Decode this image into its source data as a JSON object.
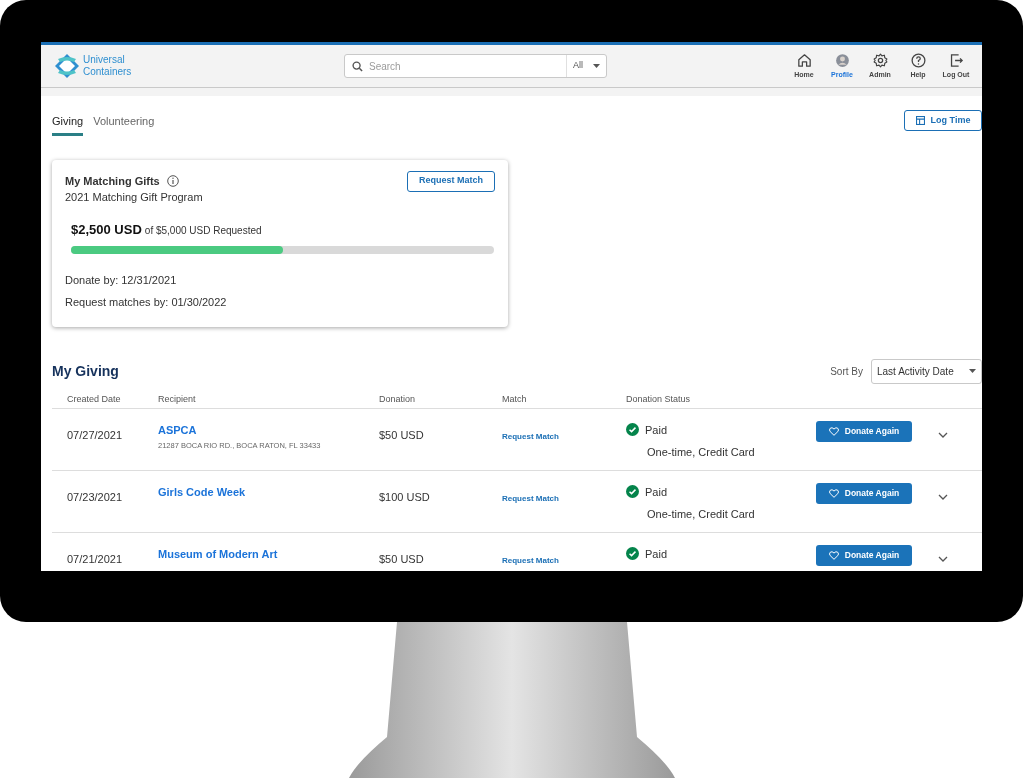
{
  "header": {
    "logo": [
      "Universal",
      "Containers"
    ],
    "search": {
      "placeholder": "Search",
      "scope": "All"
    },
    "nav": [
      {
        "label": "Home",
        "kind": "home",
        "selected": false
      },
      {
        "label": "Profile",
        "kind": "avatar",
        "selected": true
      },
      {
        "label": "Admin",
        "kind": "gear",
        "selected": false
      },
      {
        "label": "Help",
        "kind": "help",
        "selected": false
      },
      {
        "label": "Log Out",
        "kind": "logout",
        "selected": false
      }
    ]
  },
  "tabs": [
    {
      "label": "Giving",
      "selected": true
    },
    {
      "label": "Volunteering",
      "selected": false
    }
  ],
  "log_time_button": "Log Time",
  "matching_gifts": {
    "title": "My Matching Gifts",
    "button": "Request Match",
    "program": "2021 Matching Gift Program",
    "amount": "$2,500 USD",
    "amount_of": "of $5,000 USD Requested",
    "level": 0.5,
    "donate_by": "Donate by: 12/31/2021",
    "request_by": "Request matches by: 01/30/2022"
  },
  "my_giving": {
    "title": "My Giving",
    "sort_label": "Sort By",
    "sort_value": "Last Activity Date",
    "columns": [
      "Created Date",
      "Recipient",
      "Donation",
      "Match",
      "Donation Status"
    ],
    "rows": [
      {
        "date": "07/27/2021",
        "recipient": "ASPCA",
        "address": "21287 BOCA RIO RD., BOCA RATON, FL 33433",
        "donation": "$50 USD",
        "match": "Request Match",
        "status": "Paid",
        "payment": "One-time, Credit Card",
        "action": "Donate Again"
      },
      {
        "date": "07/23/2021",
        "recipient": "Girls Code Week",
        "donation": "$100 USD",
        "match": "Request Match",
        "status": "Paid",
        "payment": "One-time, Credit Card",
        "action": "Donate Again"
      },
      {
        "date": "07/21/2021",
        "recipient": "Museum of Modern Art",
        "donation": "$50 USD",
        "match": "Request Match",
        "status": "Paid",
        "action": "Donate Again"
      }
    ]
  }
}
